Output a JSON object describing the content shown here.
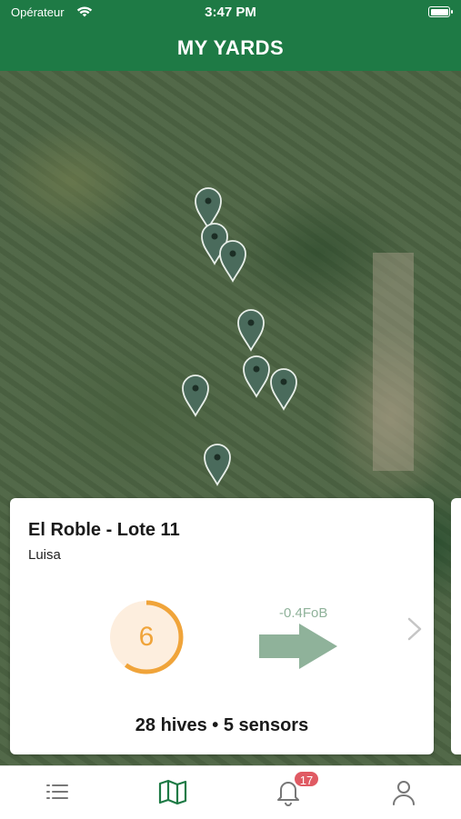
{
  "status_bar": {
    "carrier": "Opérateur",
    "time": "3:47 PM"
  },
  "header": {
    "title": "MY YARDS"
  },
  "map": {
    "pins_icon": "map-pin-icon"
  },
  "yard_card": {
    "name": "El Roble - Lote 11",
    "owner": "Luisa",
    "score": "6",
    "score_fraction": 0.6,
    "trend": "-0.4FoB",
    "summary": "28 hives • 5 sensors"
  },
  "colors": {
    "brand_green": "#1e7a45",
    "score_orange": "#f0a43a",
    "trend_green": "#8fb29a",
    "badge_red": "#e05a63"
  },
  "tab_bar": {
    "tabs": [
      {
        "icon": "list-icon"
      },
      {
        "icon": "map-icon",
        "active": true
      },
      {
        "icon": "bell-icon",
        "badge": "17"
      },
      {
        "icon": "user-icon"
      }
    ]
  }
}
